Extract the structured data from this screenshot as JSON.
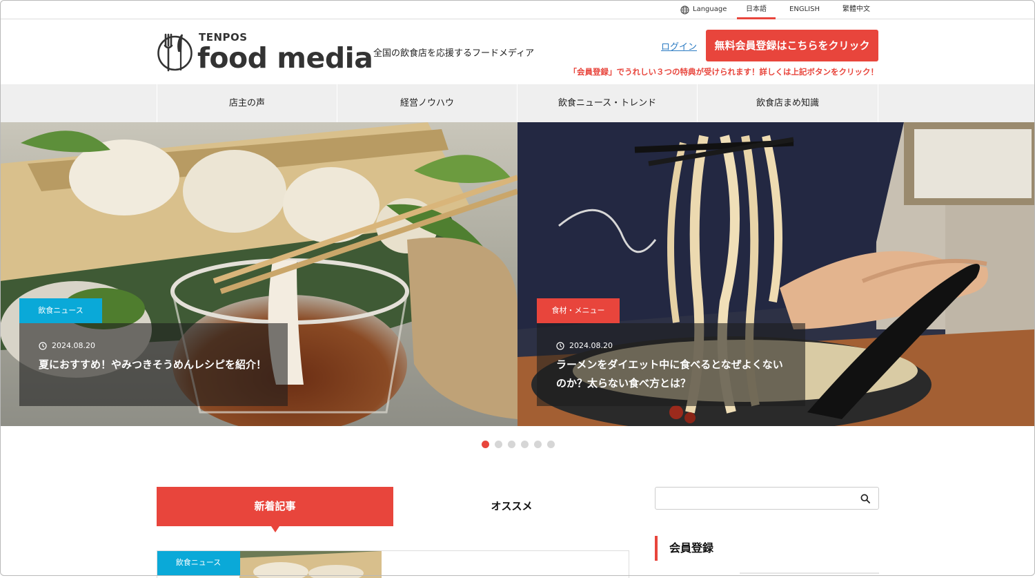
{
  "language_bar": {
    "label": "Language",
    "options": [
      "日本語",
      "ENGLISH",
      "繁體中文"
    ],
    "active": "日本語"
  },
  "header": {
    "logo_small": "TENPOS",
    "logo_main": "food media",
    "tagline": "全国の飲食店を応援するフードメディア",
    "login": "ログイン",
    "register_button": "無料会員登録はこちらをクリック",
    "register_note": "「会員登録」でうれしい３つの特典が受けられます！詳しくは上記ボタンをクリック！"
  },
  "nav": {
    "items": [
      "店主の声",
      "経営ノウハウ",
      "飲食ニュース・トレンド",
      "飲食店まめ知識"
    ]
  },
  "slides": [
    {
      "category": "飲食ニュース",
      "category_color": "#0aa9d8",
      "date": "2024.08.20",
      "title": "夏におすすめ！やみつきそうめんレシピを紹介！"
    },
    {
      "category": "食材・メニュー",
      "category_color": "#e8453c",
      "date": "2024.08.20",
      "title": "ラーメンをダイエット中に食べるとなぜよくない\nのか？太らない食べ方とは？"
    }
  ],
  "slider_dots": {
    "count": 6,
    "active_index": 0
  },
  "tabs": {
    "new": "新着記事",
    "recommended": "オススメ"
  },
  "article_preview": {
    "category": "飲食ニュース"
  },
  "sidebar": {
    "search_placeholder": "",
    "member_heading": "会員登録"
  },
  "colors": {
    "accent": "#e8453c",
    "news_blue": "#0aa9d8"
  }
}
